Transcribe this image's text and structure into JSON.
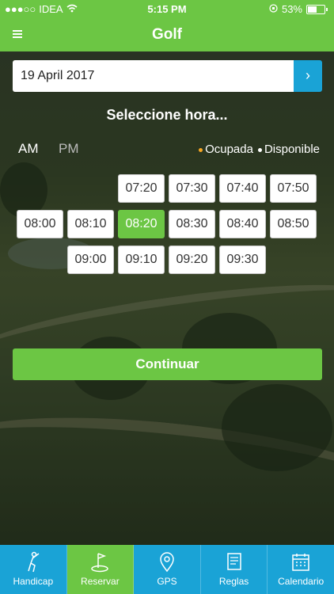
{
  "status_bar": {
    "carrier": "IDEA",
    "time": "5:15 PM",
    "battery": "53%"
  },
  "nav": {
    "title": "Golf"
  },
  "date": {
    "value": "19 April 2017"
  },
  "hint": "Seleccione hora...",
  "period": {
    "am": "AM",
    "pm": "PM",
    "selected": "AM"
  },
  "legend": {
    "occupied": "Ocupada",
    "available": "Disponible",
    "occupied_color": "#f5a623",
    "available_color": "#ffffff"
  },
  "time_slots": {
    "row1": [
      "07:20",
      "07:30",
      "07:40",
      "07:50"
    ],
    "row2": [
      "08:00",
      "08:10",
      "08:20",
      "08:30",
      "08:40",
      "08:50"
    ],
    "row3": [
      "09:00",
      "09:10",
      "09:20",
      "09:30"
    ],
    "selected": "08:20"
  },
  "continue_label": "Continuar",
  "tabs": [
    {
      "label": "Handicap",
      "icon": "golfer-icon",
      "active": false
    },
    {
      "label": "Reservar",
      "icon": "flag-hole-icon",
      "active": true
    },
    {
      "label": "GPS",
      "icon": "map-pin-icon",
      "active": false
    },
    {
      "label": "Reglas",
      "icon": "rulebook-icon",
      "active": false
    },
    {
      "label": "Calendario",
      "icon": "calendar-icon",
      "active": false
    }
  ],
  "colors": {
    "brand_green": "#6cc644",
    "accent_blue": "#1aa3d6"
  }
}
